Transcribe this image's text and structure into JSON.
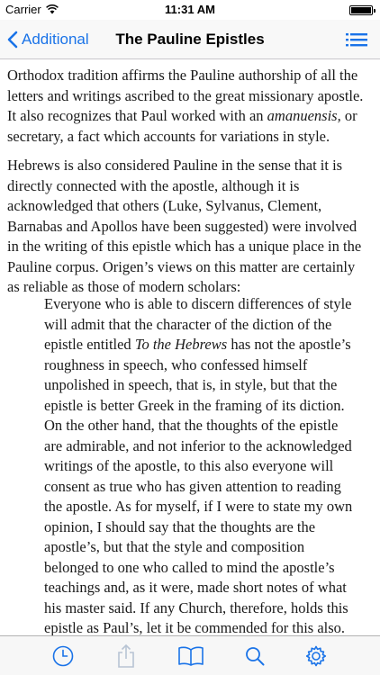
{
  "status_bar": {
    "carrier": "Carrier",
    "time": "11:31 AM"
  },
  "nav": {
    "back_label": "Additional",
    "title": "The Pauline Epistles",
    "menu_icon": "list-icon"
  },
  "content": {
    "para1_a": "Orthodox tradition affirms the Pauline authorship of all the letters and writings ascribed to the great missionary apostle. It also recognizes that Paul worked with an ",
    "para1_em": "amanuensis,",
    "para1_b": " or secretary, a fact which accounts for variations in style.",
    "para2": "Hebrews is also considered Pauline in the sense that it is directly connected with the apostle, although it is acknowledged that others (Luke, Sylvanus, Clement, Barnabas and Apollos have been suggested) were involved in the writing of this epistle which has a unique place in the Pauline corpus. Origen’s views on this matter are certainly as reliable as those of modern scholars:",
    "quote_a": "Everyone who is able to discern differences of style will admit that the character of the diction of the epistle entitled ",
    "quote_em": "To the Hebrews",
    "quote_b": " has not the apostle’s roughness in speech, who confessed himself unpolished in speech, that is, in style, but that the epistle is better Greek in the framing of its diction. On the other hand, that the thoughts of the epistle are admirable, and not inferior to the acknowledged writings of the apostle, to this also everyone will consent as true who has given attention to reading the apostle. As for myself, if I were to state my own opinion, I should say that the thoughts are the apostle’s, but that the style and composition belonged to one who called to mind the apostle’s teachings and, as it were, made short notes of what his master said. If any Church, therefore, holds this epistle as Paul’s, let it be commended for this also. For not without reason have the men of old handed it down"
  },
  "tab_bar": {
    "tabs": [
      "clock-icon",
      "share-icon",
      "book-icon",
      "search-icon",
      "gear-icon"
    ]
  },
  "colors": {
    "accent": "#1a73e8",
    "text": "#1a1a1a",
    "disabled": "#b8c4d4"
  }
}
